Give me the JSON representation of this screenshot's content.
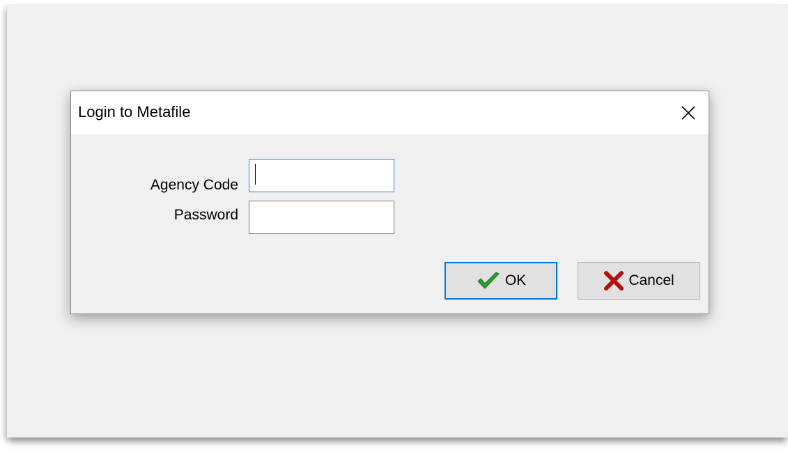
{
  "dialog": {
    "title": "Login to Metafile",
    "close_icon": "close-icon",
    "fields": {
      "agency_code": {
        "label": "Agency Code",
        "value": "",
        "placeholder": ""
      },
      "password": {
        "label": "Password",
        "value": "",
        "placeholder": ""
      }
    },
    "buttons": {
      "ok": {
        "label": "OK",
        "icon": "checkmark-icon",
        "icon_color": "#2e9e2e"
      },
      "cancel": {
        "label": "Cancel",
        "icon": "x-icon",
        "icon_color": "#b01010"
      }
    }
  },
  "colors": {
    "focus_border": "#0078d7",
    "background": "#f0f0f0"
  }
}
